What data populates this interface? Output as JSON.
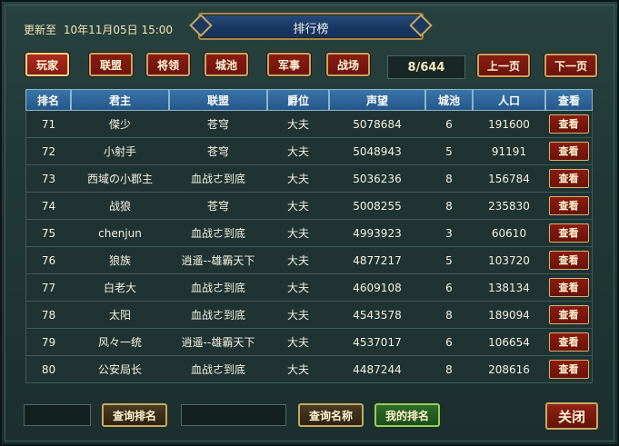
{
  "header": {
    "updated_label": "更新至",
    "updated_time": "10年11月05日 15:00",
    "title": "排行榜"
  },
  "category_tabs": [
    {
      "label": "玩家",
      "active": true
    },
    {
      "label": "联盟",
      "active": false
    },
    {
      "label": "将领",
      "active": false
    },
    {
      "label": "城池",
      "active": false
    },
    {
      "label": "军事",
      "active": false
    },
    {
      "label": "战场",
      "active": false
    }
  ],
  "pagination": {
    "page_display": "8/644",
    "prev_label": "上一页",
    "next_label": "下一页"
  },
  "table": {
    "columns": [
      "排名",
      "君主",
      "联盟",
      "爵位",
      "声望",
      "城池",
      "人口",
      "查看"
    ],
    "view_label": "查看",
    "rows": [
      {
        "rank": "71",
        "lord": "傑少",
        "alliance": "苍穹",
        "title": "大夫",
        "prestige": "5078684",
        "cities": "6",
        "population": "191600"
      },
      {
        "rank": "72",
        "lord": "小射手",
        "alliance": "苍穹",
        "title": "大夫",
        "prestige": "5048943",
        "cities": "5",
        "population": "91191"
      },
      {
        "rank": "73",
        "lord": "西域の小郡主",
        "alliance": "血战ㄜ到底",
        "title": "大夫",
        "prestige": "5036236",
        "cities": "8",
        "population": "156784"
      },
      {
        "rank": "74",
        "lord": "战狼",
        "alliance": "苍穹",
        "title": "大夫",
        "prestige": "5008255",
        "cities": "8",
        "population": "235830"
      },
      {
        "rank": "75",
        "lord": "chenjun",
        "alliance": "血战ㄜ到底",
        "title": "大夫",
        "prestige": "4993923",
        "cities": "3",
        "population": "60610"
      },
      {
        "rank": "76",
        "lord": "狼族",
        "alliance": "逍遥--雄霸天下",
        "title": "大夫",
        "prestige": "4877217",
        "cities": "5",
        "population": "103720"
      },
      {
        "rank": "77",
        "lord": "白老大",
        "alliance": "血战ㄜ到底",
        "title": "大夫",
        "prestige": "4609108",
        "cities": "6",
        "population": "138134"
      },
      {
        "rank": "78",
        "lord": "太阳",
        "alliance": "血战ㄜ到底",
        "title": "大夫",
        "prestige": "4543578",
        "cities": "8",
        "population": "189094"
      },
      {
        "rank": "79",
        "lord": "风々一统",
        "alliance": "逍遥--雄霸天下",
        "title": "大夫",
        "prestige": "4537017",
        "cities": "6",
        "population": "106654"
      },
      {
        "rank": "80",
        "lord": "公安局长",
        "alliance": "血战ㄜ到底",
        "title": "大夫",
        "prestige": "4487244",
        "cities": "8",
        "population": "208616"
      }
    ]
  },
  "footer": {
    "rank_query_value": "",
    "rank_query_button": "查询排名",
    "name_query_value": "",
    "name_query_button": "查询名称",
    "my_rank_button": "我的排名",
    "close_button": "关闭"
  }
}
